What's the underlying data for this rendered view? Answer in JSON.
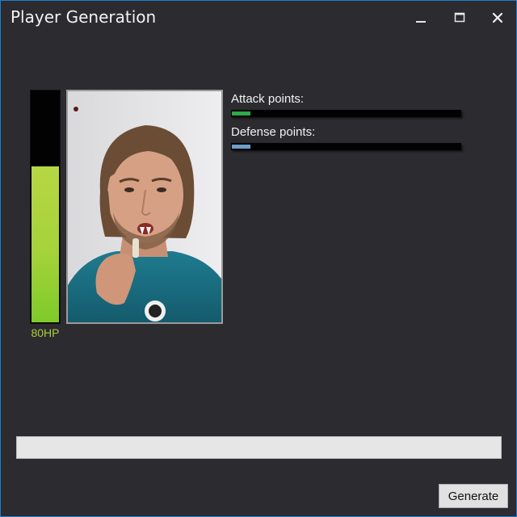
{
  "window": {
    "title": "Player Generation",
    "controls": [
      "minimize-icon",
      "maximize-icon",
      "close-icon"
    ]
  },
  "player": {
    "hp_label": "80HP",
    "hp_fraction": 0.67,
    "hp_color": "#a5d23b"
  },
  "stats": [
    {
      "label": "Attack points:",
      "fraction": 0.08,
      "color": "#2fa84a"
    },
    {
      "label": "Defense points:",
      "fraction": 0.08,
      "color": "#6f9dcc"
    }
  ],
  "progress": {
    "fraction": 0
  },
  "actions": {
    "generate_label": "Generate"
  }
}
